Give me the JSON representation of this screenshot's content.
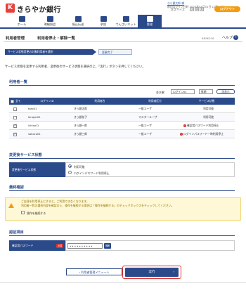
{
  "header": {
    "bank_name": "きらやか銀行",
    "logo_glyph": "K",
    "user_name": "きら銀太郎 様",
    "last_login": "前回ログイン日時 2020年01月01日 12時00分",
    "font_size_label": "文字サイズ",
    "size_small": "小",
    "size_medium": "中",
    "size_large": "大",
    "logout_label": "ログアウト"
  },
  "nav": {
    "tabs": [
      {
        "label": "ホーム",
        "icon": "home-icon"
      },
      {
        "label": "明細照会",
        "icon": "statement-icon"
      },
      {
        "label": "振込伝送",
        "icon": "transfer-icon"
      },
      {
        "label": "承認",
        "icon": "approval-icon"
      },
      {
        "label": "でんさいネット",
        "icon": "densai-icon"
      },
      {
        "label": "管理",
        "icon": "settings-icon"
      }
    ],
    "active_index": 5
  },
  "page": {
    "title_left": "利用者管理",
    "title_right": "利用者停止・解除一覧",
    "screen_id": "BRSK016",
    "help_label": "ヘルプ",
    "help_icon": "?"
  },
  "steps": {
    "step1": "サービス状態変更の対象利用者を選択",
    "step2": "変更完了"
  },
  "instruction": "サービス状態を変更する利用者、変更後のサービス状態を選択の上、「実行」ボタンを押してください。",
  "user_list": {
    "heading": "利用者一覧",
    "sort_label": "並び順：",
    "sort_key": "ログインID",
    "sort_order": "昇順",
    "reshow_label": "再表示",
    "columns": [
      "全て",
      "ログインID",
      "利用者名",
      "利用者区分",
      "サービス状態"
    ],
    "rows": [
      {
        "checked": false,
        "login_id": "taro01",
        "name": "きら銀太郎",
        "type": "一般ユーザ",
        "status": "利用可能",
        "warn": false
      },
      {
        "checked": false,
        "login_id": "kirogin01",
        "name": "きら銀花子",
        "type": "マスターユーザ",
        "status": "利用可能",
        "warn": false
      },
      {
        "checked": true,
        "login_id": "ichiro01",
        "name": "きら銀一郎",
        "type": "一般ユーザ",
        "status": "確認用パスワード利用停止",
        "warn": true
      },
      {
        "checked": true,
        "login_id": "saburo01",
        "name": "きら銀三郎",
        "type": "一般ユーザ",
        "status": "ログインパスワード一時利用停止",
        "warn": true
      }
    ]
  },
  "after_status": {
    "heading": "変更後サービス状態",
    "label": "変更後サービス状態",
    "options": [
      "利用可能",
      "ログインパスワード利用停止"
    ],
    "selected_index": 0
  },
  "confirm": {
    "heading": "最終確認",
    "message_line1": "ご自身を利用停止にすると、ご利用できなくなります。",
    "message_line2": "利用者一覧の選択内容を確認の上、操作を継続する場合は「操作を継続する」のチェックボックスをチェックしてください。",
    "checkbox_label": "操作を継続する"
  },
  "auth": {
    "heading": "認証項目",
    "label": "確認用パスワード",
    "required_badge": "必須",
    "value": "••••••••••",
    "keyboard_icon": "⌨"
  },
  "buttons": {
    "back": "利用者管理メニューへ",
    "execute": "実行"
  },
  "colors": {
    "primary": "#2b4a8a",
    "accent": "#f39c12",
    "brand_red": "#e8403a",
    "highlight": "#e03030"
  }
}
